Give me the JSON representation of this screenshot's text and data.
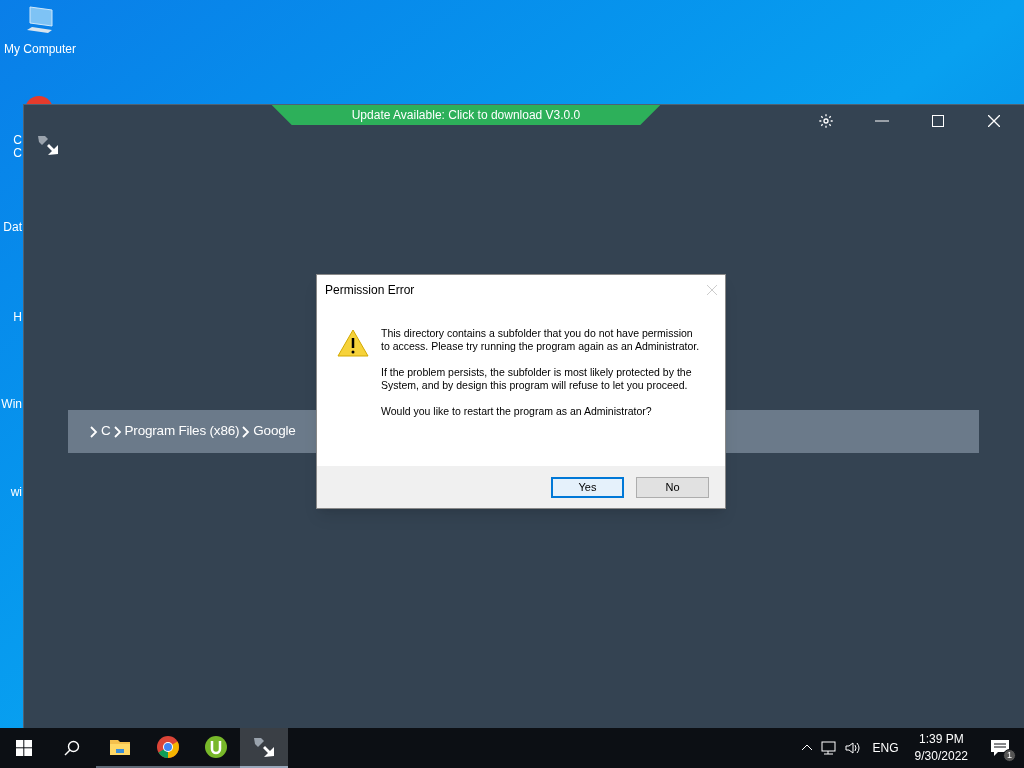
{
  "desktop": {
    "icons": [
      {
        "label": "My Computer",
        "kind": "computer"
      }
    ],
    "partial_labels": [
      "C",
      "C",
      "Dat",
      "H",
      "Win",
      "wi"
    ]
  },
  "window": {
    "update_banner": "Update Available: Click to download V3.0.0",
    "breadcrumb": [
      "C",
      "Program Files (x86)",
      "Google"
    ]
  },
  "dialog": {
    "title": "Permission Error",
    "paragraphs": [
      "This directory contains a subfolder that you do not have permission to access. Please try running the program again as an Administrator.",
      "If the problem persists, the subfolder is most likely protected by the System, and by design this program will refuse to let you proceed.",
      "Would you like to restart the program as an Administrator?"
    ],
    "buttons": [
      {
        "label": "Yes",
        "selected": true
      },
      {
        "label": "No",
        "selected": false
      }
    ]
  },
  "taskbar": {
    "apps": [
      {
        "kind": "folder",
        "active": false
      },
      {
        "kind": "browser",
        "active": false
      },
      {
        "kind": "torrent",
        "active": false
      },
      {
        "kind": "app",
        "active": true
      }
    ],
    "language": "ENG",
    "time": "1:39 PM",
    "date": "9/30/2022",
    "notification_count": "1"
  }
}
